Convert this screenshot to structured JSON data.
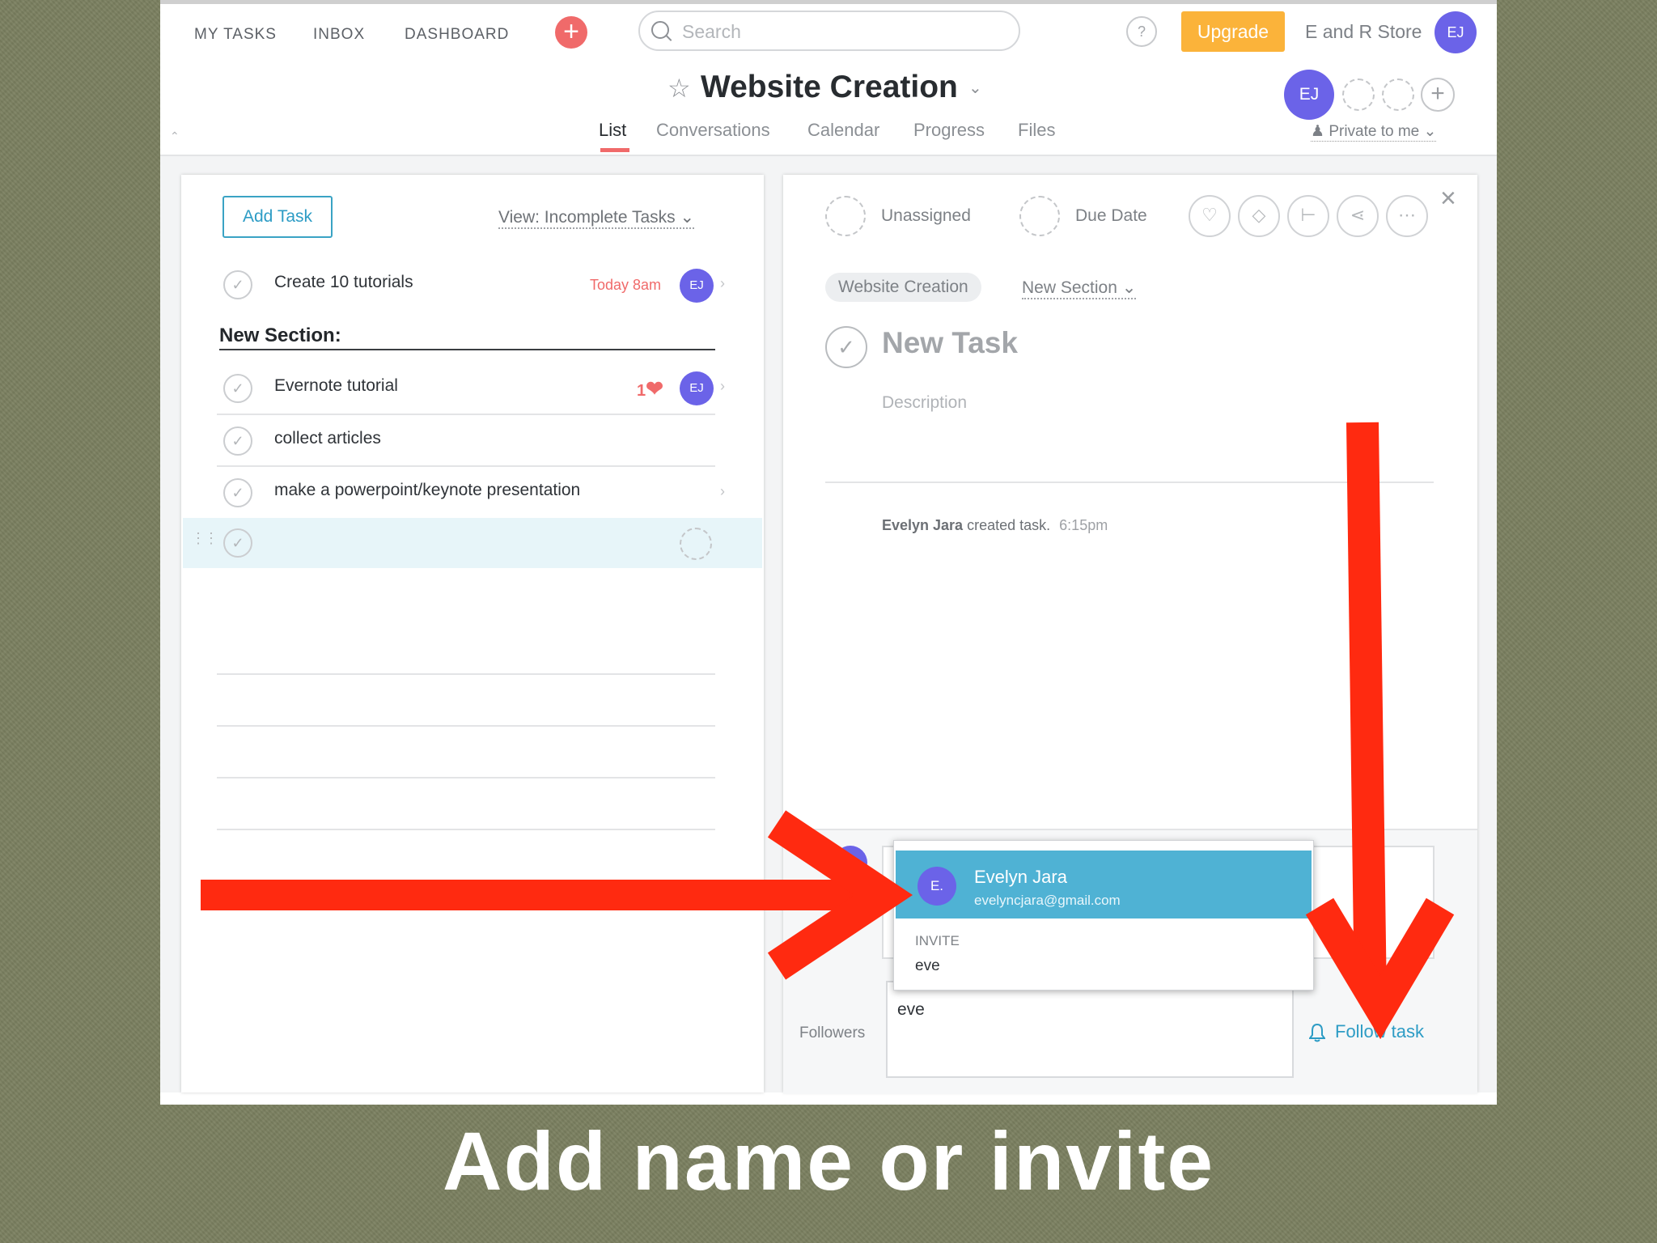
{
  "topnav": {
    "my_tasks": "MY TASKS",
    "inbox": "INBOX",
    "dashboard": "DASHBOARD",
    "search_placeholder": "Search",
    "help": "?",
    "upgrade": "Upgrade",
    "org_name": "E and R Store",
    "user_initials": "EJ"
  },
  "project": {
    "title": "Website Creation",
    "tabs": [
      "List",
      "Conversations",
      "Calendar",
      "Progress",
      "Files"
    ],
    "active_tab": "List",
    "member_initials": "EJ",
    "privacy": "Private to me"
  },
  "task_list": {
    "add_task": "Add Task",
    "view_filter": "View: Incomplete Tasks",
    "tasks": [
      {
        "name": "Create 10 tutorials",
        "due": "Today 8am",
        "assignee": "EJ"
      },
      {
        "name": "Evernote tutorial",
        "likes": "1",
        "assignee": "EJ"
      },
      {
        "name": "collect articles"
      },
      {
        "name": "make a powerpoint/keynote presentation"
      }
    ],
    "section_header": "New Section:"
  },
  "task_detail": {
    "assignee": "Unassigned",
    "due_date": "Due Date",
    "project_pill": "Website Creation",
    "section": "New Section",
    "title_placeholder": "New Task",
    "description_placeholder": "Description",
    "activity_user": "Evelyn Jara",
    "activity_action": "created task.",
    "activity_time": "6:15pm",
    "followers_label": "Followers",
    "followers_input": "eve",
    "follow_task": "Follow task"
  },
  "mention_dropdown": {
    "suggestion_initials": "E.",
    "suggestion_name": "Evelyn Jara",
    "suggestion_email": "evelyncjara@gmail.com",
    "invite_label": "INVITE",
    "invite_value": "eve"
  },
  "caption": "Add name or invite",
  "colors": {
    "background": "#7b8060",
    "accent_red": "#f06a6a",
    "upgrade": "#fbb33a",
    "avatar": "#6b63e8",
    "link_blue": "#2d9cc5",
    "highlight": "#4fb2d4",
    "annotation_arrow": "#ff2a10"
  }
}
